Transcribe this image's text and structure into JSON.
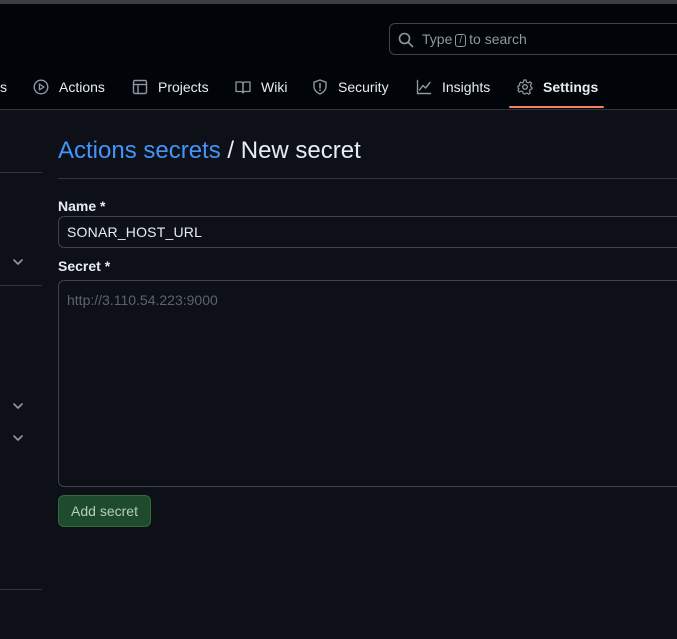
{
  "search": {
    "placeholder_prefix": "Type",
    "shortcut_key": "/",
    "placeholder_suffix": "to search"
  },
  "tabs": [
    {
      "label": "s",
      "icon": "partial-tab"
    },
    {
      "label": "Actions",
      "icon": "play-icon"
    },
    {
      "label": "Projects",
      "icon": "table-icon"
    },
    {
      "label": "Wiki",
      "icon": "book-icon"
    },
    {
      "label": "Security",
      "icon": "shield-icon"
    },
    {
      "label": "Insights",
      "icon": "graph-icon"
    },
    {
      "label": "Settings",
      "icon": "gear-icon",
      "active": true
    }
  ],
  "breadcrumb": {
    "parent": "Actions secrets",
    "separator": "/",
    "current": "New secret"
  },
  "form": {
    "name_label": "Name *",
    "name_value": "SONAR_HOST_URL",
    "secret_label": "Secret *",
    "secret_placeholder": "http://3.110.54.223:9000",
    "submit_label": "Add secret"
  },
  "colors": {
    "accent_link": "#4493f8",
    "active_tab_underline": "#f78166",
    "button_green": "#1d4b2c"
  }
}
